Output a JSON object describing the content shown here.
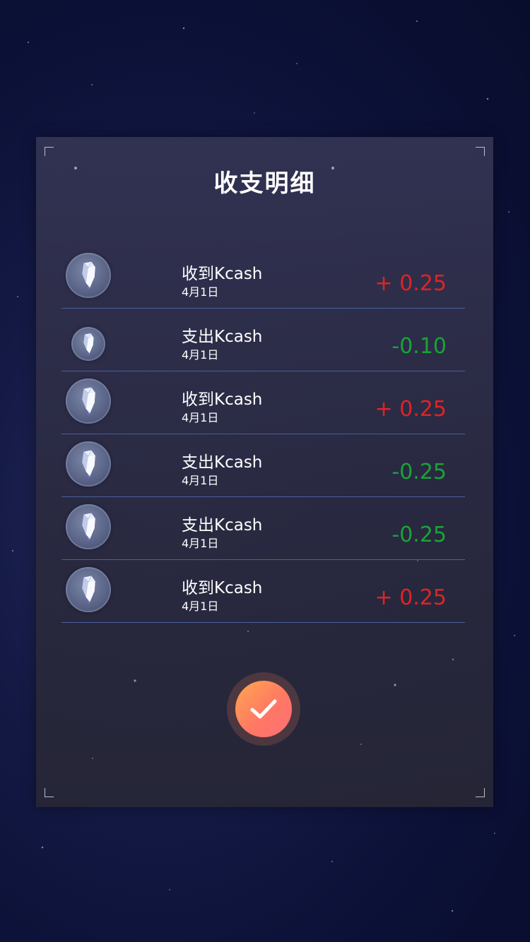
{
  "dialog": {
    "title": "收支明细",
    "confirm_icon": "check-icon"
  },
  "records": [
    {
      "name": "收到Kcash",
      "date": "4月1日",
      "amount": "+ 0.25",
      "type": "income",
      "icon": "crystal-icon"
    },
    {
      "name": "支出Kcash",
      "date": "4月1日",
      "amount": "-0.10",
      "type": "expense",
      "icon": "crystal-icon"
    },
    {
      "name": "收到Kcash",
      "date": "4月1日",
      "amount": "+ 0.25",
      "type": "income",
      "icon": "crystal-icon"
    },
    {
      "name": "支出Kcash",
      "date": "4月1日",
      "amount": "-0.25",
      "type": "expense",
      "icon": "crystal-icon"
    },
    {
      "name": "支出Kcash",
      "date": "4月1日",
      "amount": "-0.25",
      "type": "expense",
      "icon": "crystal-icon"
    },
    {
      "name": "收到Kcash",
      "date": "4月1日",
      "amount": "+ 0.25",
      "type": "income",
      "icon": "crystal-icon"
    }
  ],
  "colors": {
    "income": "#e02323",
    "expense": "#1aa336",
    "button_gradient_start": "#ffa84f",
    "button_gradient_end": "#ff6e76"
  }
}
